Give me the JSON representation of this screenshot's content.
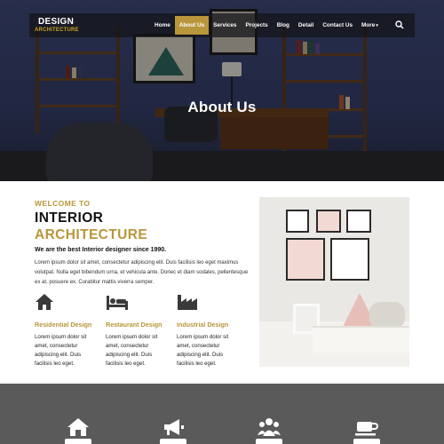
{
  "brand": {
    "name": "DESIGN",
    "sub": "ARCHITECTURE"
  },
  "nav": {
    "items": [
      {
        "label": "Home",
        "active": false
      },
      {
        "label": "About Us",
        "active": true
      },
      {
        "label": "Services",
        "active": false
      },
      {
        "label": "Projects",
        "active": false
      },
      {
        "label": "Blog",
        "active": false
      },
      {
        "label": "Detail",
        "active": false
      },
      {
        "label": "Contact Us",
        "active": false
      },
      {
        "label": "More",
        "active": false
      }
    ],
    "search_icon": "search-icon"
  },
  "hero": {
    "title": "About Us"
  },
  "about": {
    "eyebrow": "WELCOME TO",
    "heading_line1": "INTERIOR",
    "heading_line2": "ARCHITECTURE",
    "tagline": "We are the best Interior designer since 1990.",
    "paragraph": "Lorem ipsum dolor sit amet, consectetur adipiscing elit. Duis facilisis leo eget maximus volutpat. Nulla eget bibendum urna, et vehicula ante. Donec et diam sodales, pellentesque ex at, posuere ex. Curabitur mattis viverra semper."
  },
  "features": [
    {
      "icon": "house-icon",
      "title": "Residential Design",
      "text": "Lorem ipsum dolor sit amet, consectetur adipiscing elit. Duis facilisis leo eget."
    },
    {
      "icon": "bed-icon",
      "title": "Restaurant Design",
      "text": "Lorem ipsum dolor sit amet, consectetur adipiscing elit. Duis facilisis leo eget."
    },
    {
      "icon": "factory-icon",
      "title": "Industrial Design",
      "text": "Lorem ipsum dolor sit amet, consectetur adipiscing elit. Duis facilisis leo eget."
    }
  ],
  "band_icons": [
    "house-icon",
    "megaphone-icon",
    "users-icon",
    "coffee-cup-icon"
  ],
  "colors": {
    "accent": "#b8963a",
    "band": "#5a5a5a",
    "nav_bg": "#141418"
  }
}
